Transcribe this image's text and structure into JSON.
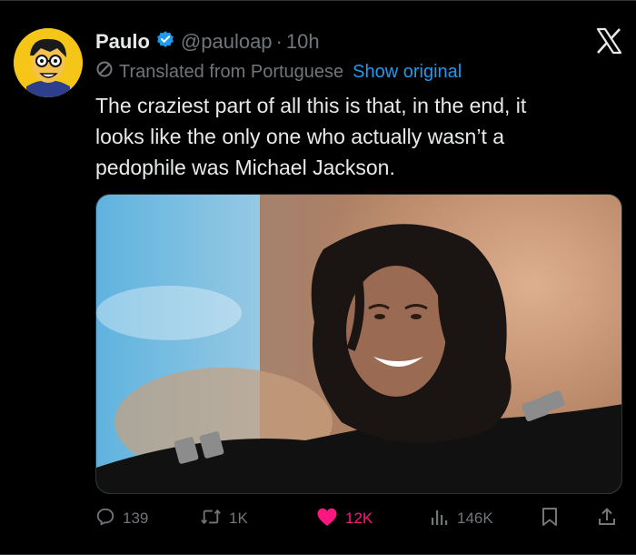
{
  "author": {
    "name": "Paulo",
    "handle": "@pauloap",
    "separator": "·",
    "time": "10h"
  },
  "translation": {
    "note": "Translated from Portuguese",
    "show_original": "Show original"
  },
  "tweet": {
    "text_lines": [
      "The craziest part of all this is that, in the end, it",
      "looks like the only one who actually wasn’t a",
      "pedophile was Michael Jackson."
    ]
  },
  "actions": {
    "replies": "139",
    "reposts": "1K",
    "likes": "12K",
    "views": "146K"
  },
  "colors": {
    "background": "#000000",
    "text": "#e7e9ea",
    "muted": "#71767b",
    "link": "#1d9bf0",
    "like": "#f91880",
    "verified": "#1d9bf0"
  },
  "icons": [
    "verified-badge-icon",
    "x-logo-icon",
    "translate-icon",
    "reply-icon",
    "repost-icon",
    "like-icon",
    "views-icon",
    "bookmark-icon",
    "share-icon"
  ]
}
